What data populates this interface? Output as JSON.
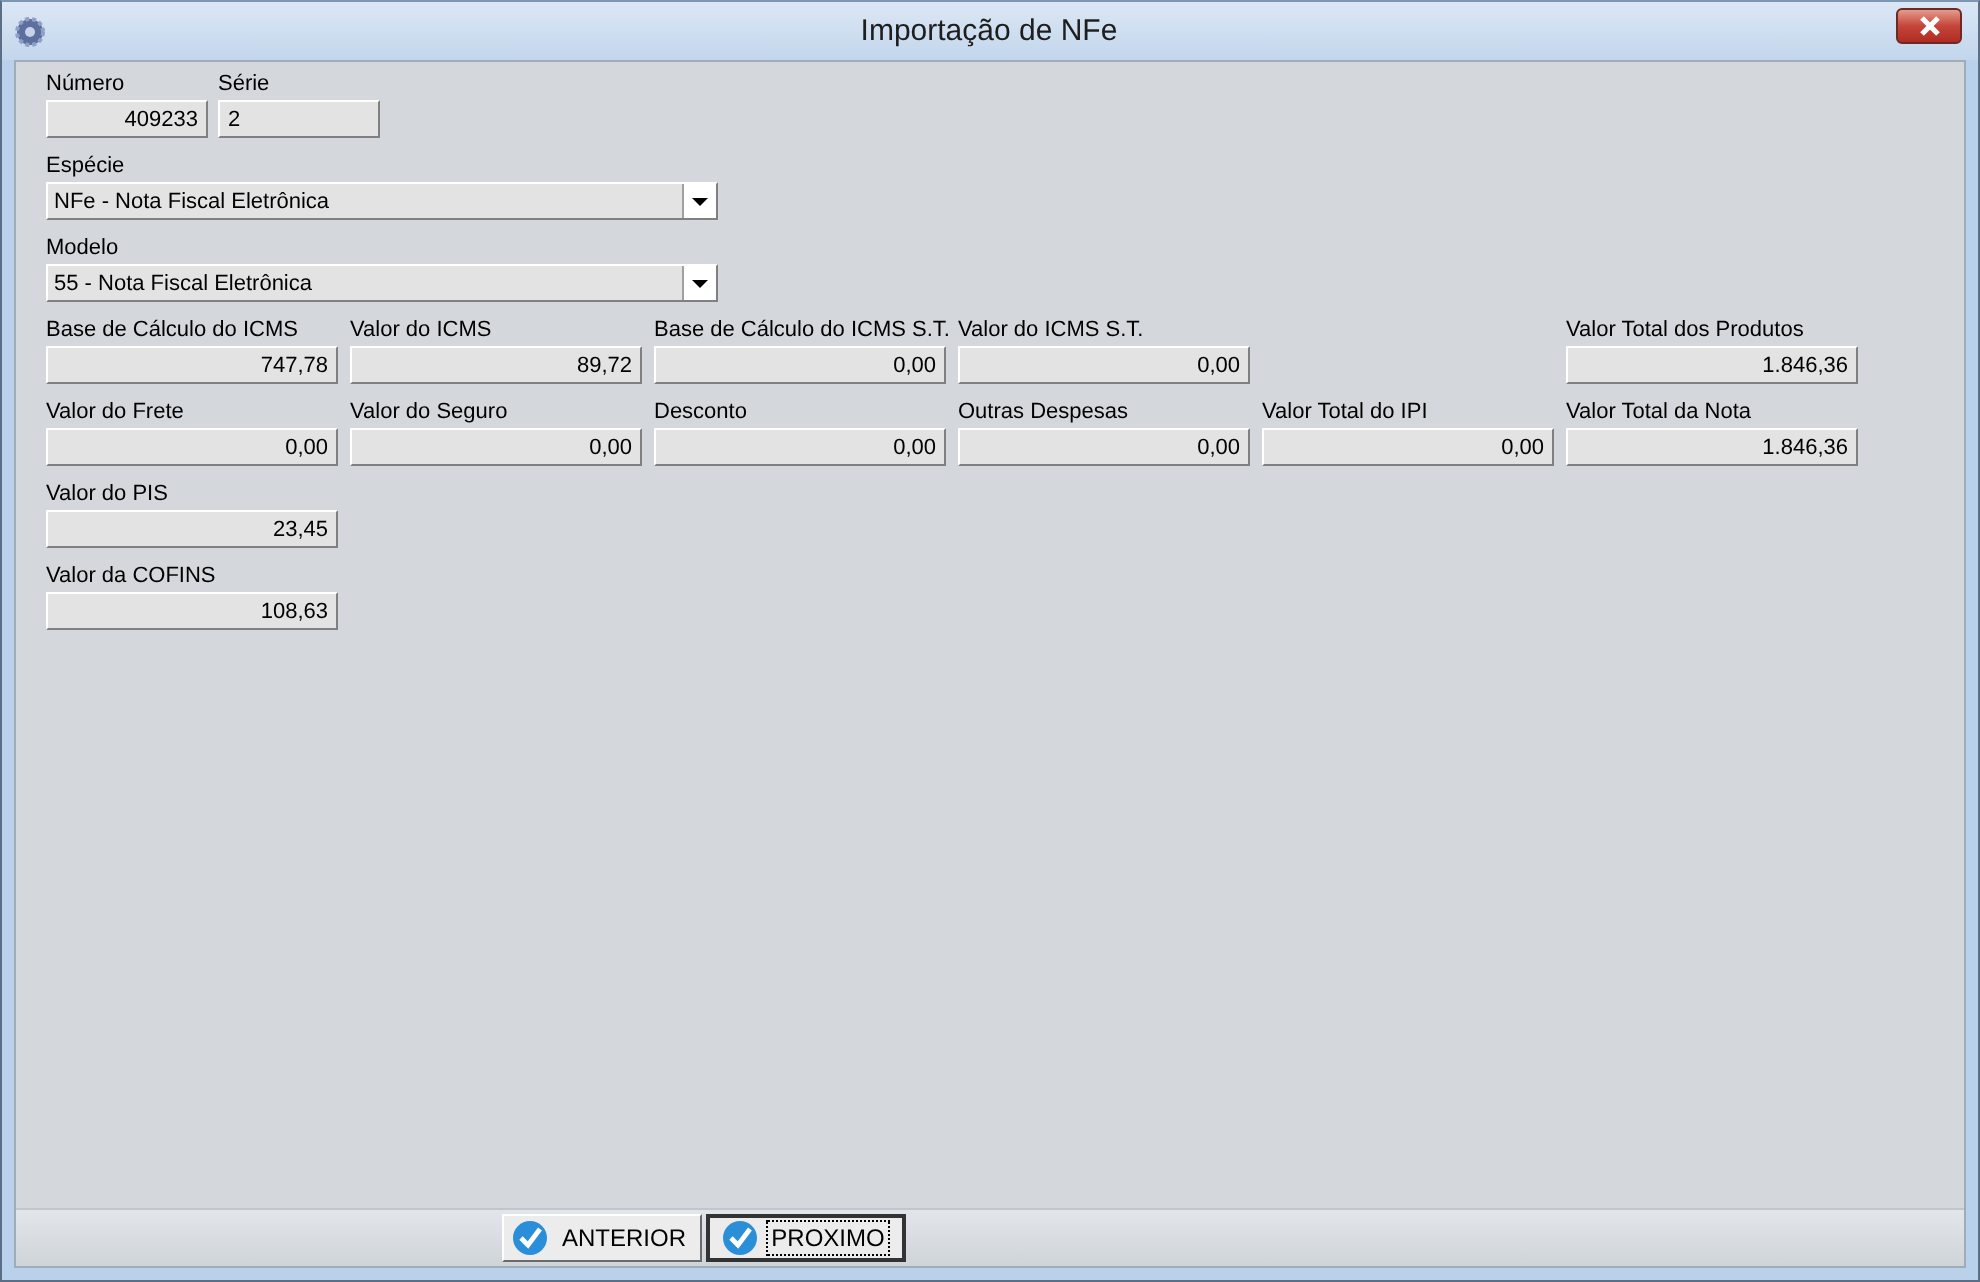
{
  "window": {
    "title": "Importação de NFe"
  },
  "header_fields": [
    {
      "label": "Número",
      "value": "409233",
      "kind": "number"
    },
    {
      "label": "Série",
      "value": "2",
      "kind": "text"
    }
  ],
  "dropdowns": [
    {
      "label": "Espécie",
      "value": "NFe - Nota Fiscal Eletrônica"
    },
    {
      "label": "Modelo",
      "value": "55 - Nota Fiscal Eletrônica"
    }
  ],
  "value_rows": [
    [
      {
        "label": "Base de Cálculo do ICMS",
        "value": "747,78"
      },
      {
        "label": "Valor do ICMS",
        "value": "89,72"
      },
      {
        "label": "Base de Cálculo do ICMS S.T.",
        "value": "0,00"
      },
      {
        "label": "Valor do ICMS S.T.",
        "value": "0,00"
      },
      {
        "label": "Valor Total dos Produtos",
        "value": "1.846,36"
      }
    ],
    [
      {
        "label": "Valor do Frete",
        "value": "0,00"
      },
      {
        "label": "Valor do Seguro",
        "value": "0,00"
      },
      {
        "label": "Desconto",
        "value": "0,00"
      },
      {
        "label": "Outras Despesas",
        "value": "0,00"
      },
      {
        "label": "Valor Total do IPI",
        "value": "0,00"
      },
      {
        "label": "Valor Total da Nota",
        "value": "1.846,36"
      }
    ],
    [
      {
        "label": "Valor do PIS",
        "value": "23,45"
      }
    ],
    [
      {
        "label": "Valor da COFINS",
        "value": "108,63"
      }
    ]
  ],
  "buttons": [
    {
      "label": "ANTERIOR",
      "focused": false
    },
    {
      "label": "PROXIMO",
      "focused": true
    }
  ]
}
